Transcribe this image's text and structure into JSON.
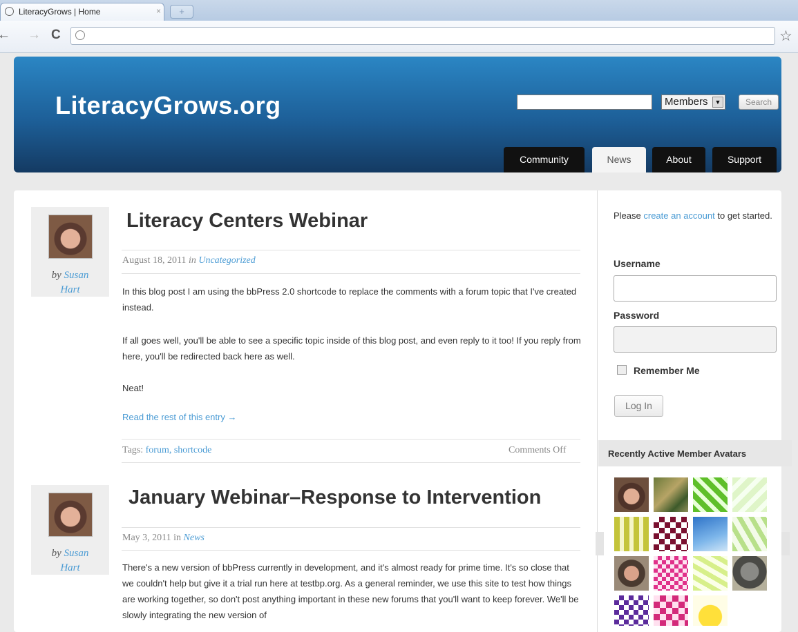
{
  "browser": {
    "tab_title": "LiteracyGrows | Home",
    "tab_close": "×",
    "new_tab": "+",
    "back": "←",
    "forward": "→",
    "reload": "C",
    "bookmark_star": "☆"
  },
  "header": {
    "site_title": "LiteracyGrows.org",
    "search_scope": "Members",
    "search_button": "Search",
    "nav": [
      "Community",
      "News",
      "About",
      "Support"
    ],
    "active_nav": "News"
  },
  "posts": [
    {
      "title": "Literacy Centers Webinar",
      "by": "by",
      "author_first": "Susan",
      "author_last": "Hart",
      "date": "August 18, 2011",
      "in": "in",
      "category": "Uncategorized",
      "paragraphs": [
        "In this blog post I am using the bbPress 2.0 shortcode to replace the comments with a forum topic that I've created instead.",
        "If all goes well, you'll be able to see a specific topic inside of this blog post, and even reply to it too! If you reply from here, you'll be redirected back here as well.",
        "Neat!"
      ],
      "read_more": "Read the rest of this entry →",
      "tags_label": "Tags:",
      "tags": "forum, shortcode",
      "comments": "Comments Off"
    },
    {
      "title": "January Webinar–Response to Intervention",
      "by": "by",
      "author_first": "Susan",
      "author_last": "Hart",
      "date": "May 3, 2011",
      "in": "in",
      "category": "News",
      "paragraphs": [
        "There's a new version of bbPress currently in development, and it's almost ready for prime time. It's so close that we couldn't help but give it a trial run here at testbp.org. As a general reminder, we use this site to test how things are working together, so don't post anything important in these new forums that you'll want to keep forever. We'll be slowly integrating the new version of"
      ]
    }
  ],
  "sidebar": {
    "prompt_before": "Please",
    "prompt_link": "create an account",
    "prompt_after": "to get started.",
    "username_label": "Username",
    "password_label": "Password",
    "remember_label": "Remember Me",
    "login_button": "Log In",
    "widget_title": "Recently Active Member Avatars"
  }
}
